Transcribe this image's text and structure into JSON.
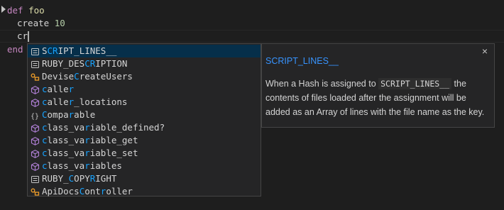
{
  "editor": {
    "lines": [
      {
        "keyword": "def",
        "name": "foo"
      },
      {
        "method": "create",
        "arg": "10"
      },
      {
        "text": "cr"
      },
      {
        "keyword": "end"
      }
    ]
  },
  "suggest": {
    "items": [
      {
        "icon": "constant-icon",
        "parts": [
          "S",
          "CR",
          "IPT_LINES__"
        ],
        "hl": [
          false,
          true,
          false
        ]
      },
      {
        "icon": "constant-icon",
        "parts": [
          "RUBY_DES",
          "CR",
          "IPTION"
        ],
        "hl": [
          false,
          true,
          false
        ]
      },
      {
        "icon": "class-icon",
        "parts": [
          "Devise",
          "C",
          "reateUsers"
        ],
        "hl": [
          false,
          true,
          false
        ]
      },
      {
        "icon": "method-icon",
        "parts": [
          "c",
          "",
          "alle",
          "r",
          ""
        ],
        "hl": [
          true,
          false,
          false,
          true,
          false
        ]
      },
      {
        "icon": "method-icon",
        "parts": [
          "c",
          "alle",
          "r",
          "_locations"
        ],
        "hl": [
          true,
          false,
          true,
          false
        ]
      },
      {
        "icon": "module-icon",
        "parts": [
          "C",
          "ompa",
          "r",
          "able"
        ],
        "hl": [
          true,
          false,
          true,
          false
        ]
      },
      {
        "icon": "method-icon",
        "parts": [
          "c",
          "lass_va",
          "r",
          "iable_defined?"
        ],
        "hl": [
          true,
          false,
          true,
          false
        ]
      },
      {
        "icon": "method-icon",
        "parts": [
          "c",
          "lass_va",
          "r",
          "iable_get"
        ],
        "hl": [
          true,
          false,
          true,
          false
        ]
      },
      {
        "icon": "method-icon",
        "parts": [
          "c",
          "lass_va",
          "r",
          "iable_set"
        ],
        "hl": [
          true,
          false,
          true,
          false
        ]
      },
      {
        "icon": "method-icon",
        "parts": [
          "c",
          "lass_va",
          "r",
          "iables"
        ],
        "hl": [
          true,
          false,
          true,
          false
        ]
      },
      {
        "icon": "constant-icon",
        "parts": [
          "RUBY_",
          "C",
          "OPY",
          "R",
          "IGHT"
        ],
        "hl": [
          false,
          true,
          false,
          true,
          false
        ]
      },
      {
        "icon": "class-icon",
        "parts": [
          "ApiDocs",
          "C",
          "ont",
          "r",
          "oller"
        ],
        "hl": [
          false,
          true,
          false,
          true,
          false
        ]
      }
    ]
  },
  "details": {
    "title": "SCRIPT_LINES__",
    "close": "×",
    "doc_before": "When a Hash is assigned to ",
    "doc_code": "SCRIPT_LINES__",
    "doc_after": " the contents of files loaded after the assignment will be added as an Array of lines with the file name as the key."
  },
  "colors": {
    "match_highlight": "#18a3ff",
    "selected_row": "#062f4a",
    "method_icon": "#b180d7",
    "class_icon": "#ee9d28"
  }
}
